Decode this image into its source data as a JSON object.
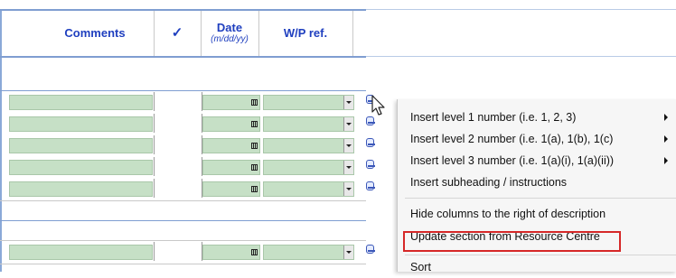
{
  "table": {
    "headers": {
      "comments": "Comments",
      "check": "✓",
      "date_label": "Date",
      "date_format": "(m/dd/yy)",
      "wp_ref": "W/P ref."
    },
    "rows_group_1_count": 5,
    "rows_group_2_count": 1
  },
  "icons": {
    "date_picker": "calendar-icon",
    "dropdown": "chevron-down-icon",
    "row_action": "row-options-icon",
    "submenu": "chevron-right-icon",
    "cursor": "mouse-pointer-icon"
  },
  "context_menu": {
    "items": [
      {
        "label": "Insert level 1 number (i.e. 1, 2, 3)",
        "submenu": true
      },
      {
        "label": "Insert level 2 number (i.e. 1(a), 1(b), 1(c)",
        "submenu": true
      },
      {
        "label": "Insert level 3 number (i.e. 1(a)(i), 1(a)(ii))",
        "submenu": true
      },
      {
        "label": "Insert subheading / instructions",
        "submenu": false
      },
      {
        "label": "Hide columns to the right of description",
        "submenu": false
      },
      {
        "label": "Update section from Resource Centre",
        "submenu": false,
        "highlighted": true
      },
      {
        "label": "Sort",
        "submenu": false
      }
    ]
  },
  "colors": {
    "header_text": "#1f3fbf",
    "input_fill": "#c6e0c6",
    "band": "#7f9ed1",
    "highlight": "#d62828"
  }
}
